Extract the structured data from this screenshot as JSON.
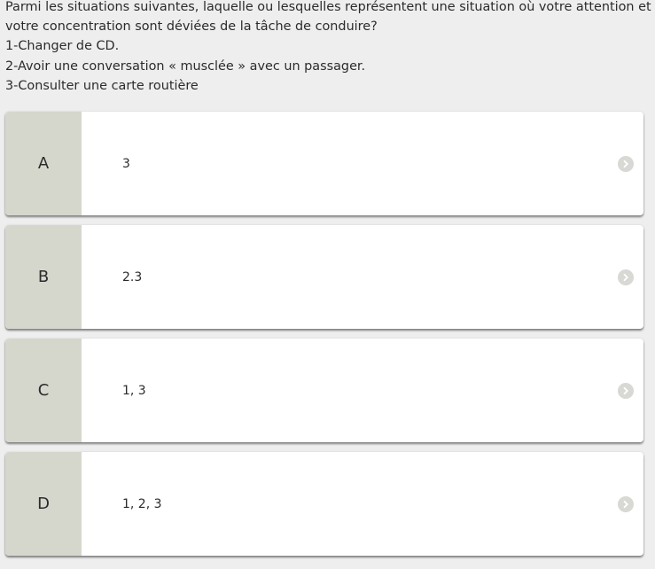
{
  "question": {
    "lines": [
      "Parmi les situations suivantes, laquelle ou lesquelles représentent une situation où votre attention et",
      "votre concentration sont déviées de la tâche de conduire?",
      "1-Changer de CD.",
      "2-Avoir une conversation « musclée » avec un passager.",
      "3-Consulter une carte routière"
    ]
  },
  "answers": [
    {
      "letter": "A",
      "text": "3"
    },
    {
      "letter": "B",
      "text": "2.3"
    },
    {
      "letter": "C",
      "text": "1, 3"
    },
    {
      "letter": "D",
      "text": "1, 2, 3"
    }
  ],
  "colors": {
    "page_background": "#eeeeee",
    "letter_panel": "#d5d7cd",
    "card_background": "#ffffff",
    "chevron_circle": "#d8d8d4",
    "text": "#2b2b2b"
  },
  "icons": {
    "answer_arrow": "chevron-right-circle-icon"
  }
}
